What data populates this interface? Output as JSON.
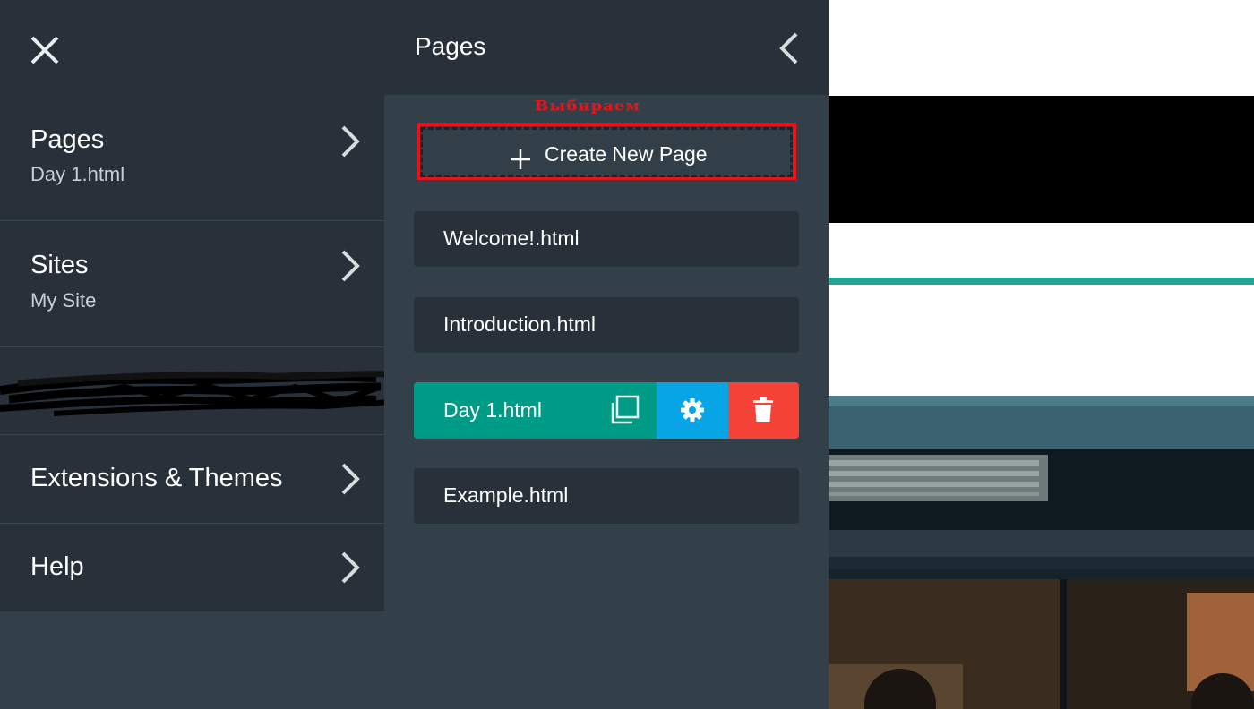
{
  "left_menu": {
    "items": [
      {
        "title": "Pages",
        "subtitle": "Day 1.html"
      },
      {
        "title": "Sites",
        "subtitle": "My Site"
      },
      {
        "title": "Extensions & Themes"
      },
      {
        "title": "Help"
      }
    ]
  },
  "pages_panel": {
    "title": "Pages",
    "annotation": "Выбираем",
    "create_button": "Create New Page",
    "pages": [
      "Welcome!.html",
      "Introduction.html",
      "Day 1.html",
      "Example.html"
    ],
    "active_page_index": 2
  },
  "colors": {
    "panel_dark": "#28313a",
    "panel_bg": "#344049",
    "active_page": "#009b86",
    "settings_button": "#08a5e6",
    "delete_button": "#f54338",
    "annotation_red": "#e8141d",
    "preview_accent": "#27a594"
  },
  "icons": [
    "close-icon",
    "chevron-right-icon",
    "chevron-left-icon",
    "plus-icon",
    "copy-icon",
    "gear-icon",
    "trash-icon"
  ]
}
